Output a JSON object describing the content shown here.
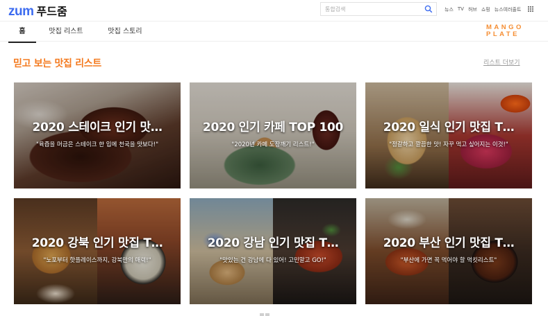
{
  "header": {
    "logo_brand": "zum",
    "logo_service": "푸드줌",
    "search_placeholder": "통합검색",
    "links": [
      "뉴스",
      "TV",
      "허브",
      "쇼핑",
      "뉴스여러줄트"
    ]
  },
  "nav": {
    "tabs": [
      {
        "label": "홈",
        "active": true
      },
      {
        "label": "맛집 리스트",
        "active": false
      },
      {
        "label": "맛집 스토리",
        "active": false
      }
    ],
    "partner_logo": {
      "line1": "MANGO",
      "line2": "PLATE"
    }
  },
  "section": {
    "title": "믿고 보는 맛집 리스트",
    "more_label": "리스트 더보기"
  },
  "cards": [
    {
      "title": "2020 스테이크 인기 맛…",
      "subtitle": "\"육즙을 머금은 스테이크 한 입에 천국을 맛보다!\""
    },
    {
      "title": "2020 인기 카페 TOP 100",
      "subtitle": "\"2020년 카페 도장깨기 리스트!\""
    },
    {
      "title": "2020 일식 인기 맛집 T…",
      "subtitle": "\"정갈하고 깔끔한 맛! 자꾸 먹고 싶어지는 이것!\""
    },
    {
      "title": "2020 강북 인기 맛집 T…",
      "subtitle": "\"노포부터 핫플레이스까지, 강북만의 매력!\""
    },
    {
      "title": "2020 강남 인기 맛집 T…",
      "subtitle": "\"맛있는 건 강남에 다 있어! 고민말고 GO!\""
    },
    {
      "title": "2020 부산 인기 맛집 T…",
      "subtitle": "\"부산에 가면 꼭 먹어야 할 먹킷리스트\""
    }
  ],
  "colors": {
    "accent": "#f47a1f",
    "brand": "#3d6cf0",
    "mango": "#f58d32"
  }
}
